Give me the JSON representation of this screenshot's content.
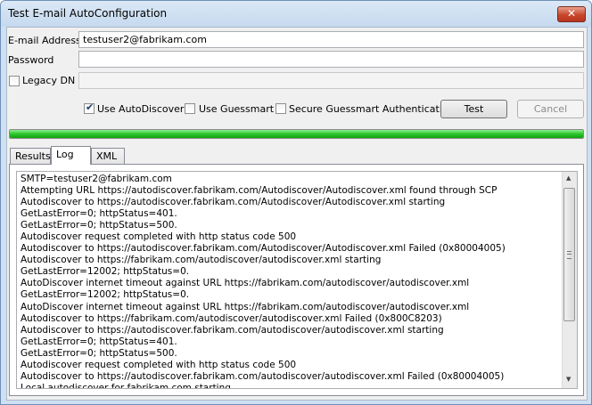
{
  "window": {
    "title": "Test E-mail AutoConfiguration",
    "close_glyph": "✕"
  },
  "form": {
    "email_label": "E-mail Address",
    "email_value": "testuser2@fabrikam.com",
    "password_label": "Password",
    "password_value": "",
    "legacy_dn_label": "Legacy DN",
    "legacy_dn_checked": false,
    "legacy_dn_value": ""
  },
  "options": {
    "use_autodiscover": {
      "label": "Use AutoDiscover",
      "checked": true
    },
    "use_guessmart": {
      "label": "Use Guessmart",
      "checked": false
    },
    "secure_guessmart": {
      "label": "Secure Guessmart Authentication",
      "checked": false
    }
  },
  "buttons": {
    "test": "Test",
    "cancel": "Cancel"
  },
  "progress": {
    "fraction": 1.0,
    "color": "#22b822"
  },
  "tabs": [
    {
      "label": "Results",
      "active": false
    },
    {
      "label": "Log",
      "active": true
    },
    {
      "label": "XML",
      "active": false
    }
  ],
  "log": {
    "lines": [
      " SMTP=testuser2@fabrikam.com",
      "Attempting URL https://autodiscover.fabrikam.com/Autodiscover/Autodiscover.xml found through SCP",
      "Autodiscover to https://autodiscover.fabrikam.com/Autodiscover/Autodiscover.xml starting",
      "GetLastError=0; httpStatus=401.",
      "GetLastError=0; httpStatus=500.",
      "Autodiscover request completed with http status code 500",
      "Autodiscover to https://autodiscover.fabrikam.com/Autodiscover/Autodiscover.xml Failed (0x80004005)",
      "Autodiscover to https://fabrikam.com/autodiscover/autodiscover.xml starting",
      "GetLastError=12002; httpStatus=0.",
      "AutoDiscover internet timeout against URL https://fabrikam.com/autodiscover/autodiscover.xml",
      "GetLastError=12002; httpStatus=0.",
      "AutoDiscover internet timeout against URL https://fabrikam.com/autodiscover/autodiscover.xml",
      "Autodiscover to https://fabrikam.com/autodiscover/autodiscover.xml Failed (0x800C8203)",
      "Autodiscover to https://autodiscover.fabrikam.com/autodiscover/autodiscover.xml starting",
      "GetLastError=0; httpStatus=401.",
      "GetLastError=0; httpStatus=500.",
      "Autodiscover request completed with http status code 500",
      "Autodiscover to https://autodiscover.fabrikam.com/autodiscover/autodiscover.xml Failed (0x80004005)",
      "Local autodiscover for fabrikam.com starting"
    ]
  },
  "icons": {
    "close": "close-icon",
    "check": "checkmark-icon",
    "scroll_up": "scroll-up-arrow-icon",
    "scroll_down": "scroll-down-arrow-icon"
  }
}
